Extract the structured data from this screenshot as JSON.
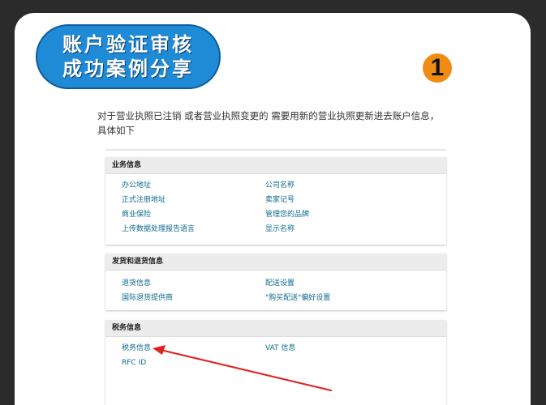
{
  "title": {
    "line1": "账户验证审核",
    "line2": "成功案例分享"
  },
  "step_number": "1",
  "intro_text": "对于营业执照已注销  或者营业执照变更的    需要用新的营业执照更新进去账户信息，具体如下",
  "sections": {
    "business": {
      "header": "业务信息",
      "links": [
        "办公地址",
        "公司名称",
        "正式注册地址",
        "卖家记号",
        "商业保险",
        "管理您的品牌",
        "上传数据处理报告语言",
        "显示名称"
      ]
    },
    "shipping": {
      "header": "发货和退货信息",
      "links": [
        "退货信息",
        "配送设置",
        "国际退货提供商",
        "\"购买配送\"偏好设置"
      ]
    },
    "tax": {
      "header": "税务信息",
      "links": [
        "税务信息",
        "VAT 信息",
        "RFC ID"
      ]
    }
  },
  "colors": {
    "badge_blue": "#1f8ad6",
    "number_orange": "#f08c14",
    "link_color": "#0d6a8f",
    "arrow_red": "#e02020"
  }
}
